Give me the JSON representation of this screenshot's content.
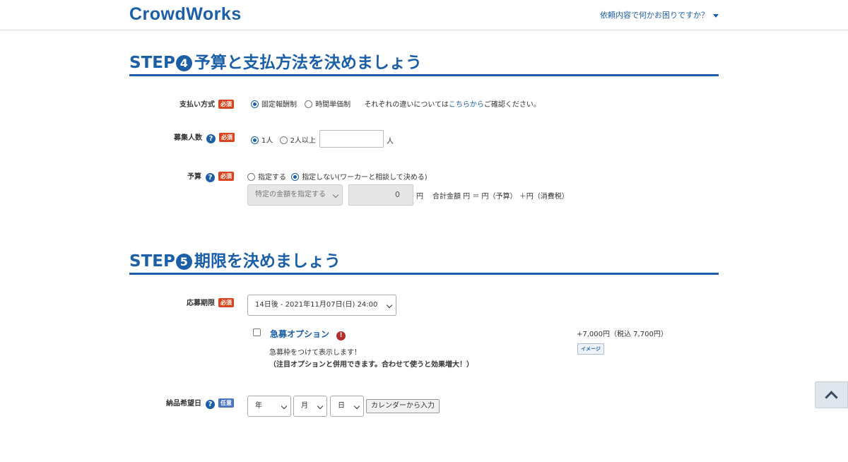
{
  "header": {
    "logo": "CrowdWorks",
    "help_link": "依頼内容で何かお困りですか？"
  },
  "step4": {
    "prefix": "STEP",
    "number": "4",
    "title": "予算と支払方法を決めましょう",
    "payment": {
      "label": "支払い方式",
      "badge": "必須",
      "option_fixed": "固定報酬制",
      "option_hourly": "時間単価制",
      "selected": "固定報酬制",
      "note_before": "それぞれの違いについては",
      "note_link": "こちらから",
      "note_after": "ご確認ください。"
    },
    "recruit": {
      "label": "募集人数",
      "badge": "必須",
      "option_one": "1人",
      "option_multi": "2人以上",
      "selected": "1人",
      "count_value": "",
      "unit": "人"
    },
    "budget": {
      "label": "予算",
      "badge": "必須",
      "option_specify": "指定する",
      "option_no_specify": "指定しない(ワーカーと相談して決める)",
      "selected": "指定しない(ワーカーと相談して決める)",
      "amount_select": "特定の金額を指定する",
      "amount_value": "0",
      "yen": "円",
      "total_text": "合計金額 円 ＝ 円（予算） ＋円（消費税）"
    }
  },
  "step5": {
    "prefix": "STEP",
    "number": "5",
    "title": "期限を決めましょう",
    "deadline": {
      "label": "応募期限",
      "badge": "必須",
      "selected": "14日後 - 2021年11月07日(日) 24:00"
    },
    "urgent": {
      "title": "急募オプション",
      "price": "+7,000円（税込 7,700円）",
      "image_button": "イメージ",
      "desc1": "急募枠をつけて表示します！",
      "desc2": "（注目オプションと併用できます。合わせて使うと効果増大！）"
    },
    "delivery": {
      "label": "納品希望日",
      "badge": "任意",
      "year": "年",
      "month": "月",
      "day": "日",
      "calendar_button": "カレンダーから入力"
    }
  },
  "colors": {
    "brand": "#1b5fa8",
    "required_badge": "#d9431e",
    "optional_badge": "#4a74c4"
  }
}
